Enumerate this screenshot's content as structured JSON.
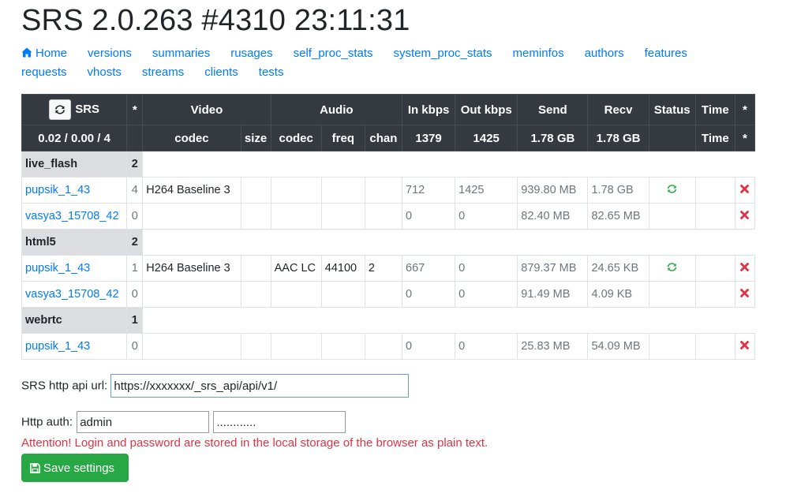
{
  "header": {
    "title": "SRS 2.0.263 #4310 23:11:31"
  },
  "nav": {
    "row1": [
      "Home",
      "versions",
      "summaries",
      "rusages",
      "self_proc_stats",
      "system_proc_stats",
      "meminfos",
      "authors",
      "features"
    ],
    "row2": [
      "requests",
      "vhosts",
      "streams",
      "clients",
      "tests"
    ]
  },
  "table": {
    "header1": {
      "refresh_label": "SRS",
      "star": "*",
      "video": "Video",
      "audio": "Audio",
      "in_kbps": "In kbps",
      "out_kbps": "Out kbps",
      "send": "Send",
      "recv": "Recv",
      "status": "Status",
      "time": "Time",
      "star2": "*"
    },
    "header2": {
      "load": "0.02 / 0.00 / 4",
      "v_codec": "codec",
      "v_size": "size",
      "a_codec": "codec",
      "a_freq": "freq",
      "a_chan": "chan",
      "in_kbps": "1379",
      "out_kbps": "1425",
      "send": "1.78 GB",
      "recv": "1.78 GB",
      "time": "Time",
      "star": "*"
    },
    "vhosts": [
      {
        "name": "live_flash",
        "count": "2",
        "streams": [
          {
            "name": "pupsik_1_43",
            "clients": "4",
            "v_codec": "H264 Baseline 3",
            "v_size": "",
            "a_codec": "",
            "a_freq": "",
            "a_chan": "",
            "in_kbps": "712",
            "out_kbps": "1425",
            "send": "939.80 MB",
            "recv": "1.78 GB",
            "status": "active",
            "time": ""
          },
          {
            "name": "vasya3_15708_42",
            "clients": "0",
            "v_codec": "",
            "v_size": "",
            "a_codec": "",
            "a_freq": "",
            "a_chan": "",
            "in_kbps": "0",
            "out_kbps": "0",
            "send": "82.40 MB",
            "recv": "82.65 MB",
            "status": "",
            "time": ""
          }
        ]
      },
      {
        "name": "html5",
        "count": "2",
        "streams": [
          {
            "name": "pupsik_1_43",
            "clients": "1",
            "v_codec": "H264 Baseline 3",
            "v_size": "",
            "a_codec": "AAC LC",
            "a_freq": "44100",
            "a_chan": "2",
            "in_kbps": "667",
            "out_kbps": "0",
            "send": "879.37 MB",
            "recv": "24.65 KB",
            "status": "active",
            "time": ""
          },
          {
            "name": "vasya3_15708_42",
            "clients": "0",
            "v_codec": "",
            "v_size": "",
            "a_codec": "",
            "a_freq": "",
            "a_chan": "",
            "in_kbps": "0",
            "out_kbps": "0",
            "send": "91.49 MB",
            "recv": "4.09 KB",
            "status": "",
            "time": ""
          }
        ]
      },
      {
        "name": "webrtc",
        "count": "1",
        "streams": [
          {
            "name": "pupsik_1_43",
            "clients": "0",
            "v_codec": "",
            "v_size": "",
            "a_codec": "",
            "a_freq": "",
            "a_chan": "",
            "in_kbps": "0",
            "out_kbps": "0",
            "send": "25.83 MB",
            "recv": "54.09 MB",
            "status": "",
            "time": ""
          }
        ]
      }
    ]
  },
  "form": {
    "api_label": "SRS http api url:",
    "api_value": "https://xxxxxxx/_srs_api/api/v1/",
    "auth_label": "Http auth:",
    "user_value": "admin",
    "password_value": "............",
    "warning": "Attention! Login and password are stored in the local storage of the browser as plain text.",
    "save_label": "Save settings"
  },
  "colors": {
    "link": "#007bff",
    "header_bg": "#343a40",
    "status_green": "#28a745",
    "delete_red": "#dc3545",
    "warning": "#dc3545"
  },
  "icons": {
    "home": "home-icon",
    "refresh": "refresh-icon",
    "status": "sync-icon",
    "delete": "delete-icon",
    "save": "floppy-disk-icon"
  }
}
